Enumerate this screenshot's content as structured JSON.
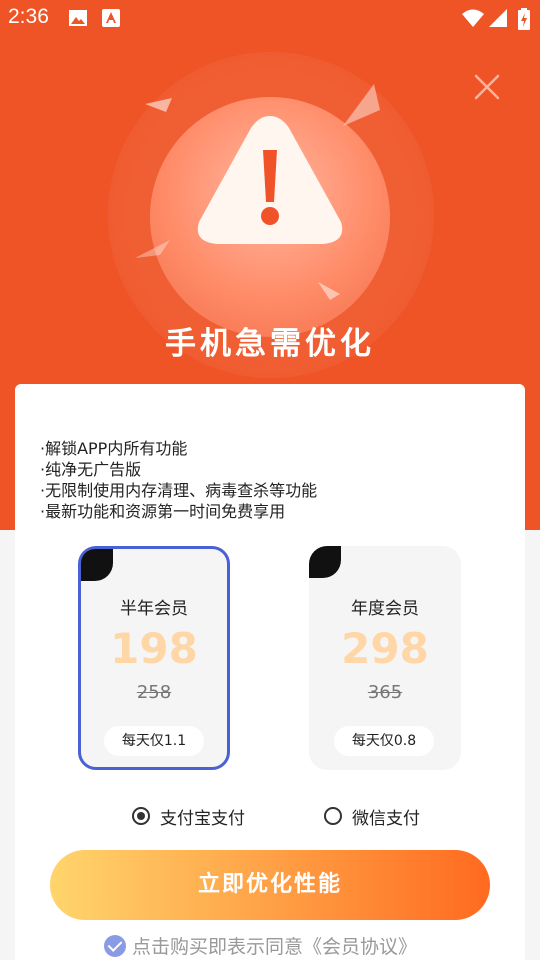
{
  "status_bar": {
    "time": "2:36"
  },
  "hero": {
    "title": "手机急需优化"
  },
  "features": [
    "·解锁APP内所有功能",
    "·纯净无广告版",
    "·无限制使用内存清理、病毒查杀等功能",
    "·最新功能和资源第一时间免费享用"
  ],
  "plans": [
    {
      "name": "半年会员",
      "price": "198",
      "original": "258",
      "daily": "每天仅1.1",
      "selected": true
    },
    {
      "name": "年度会员",
      "price": "298",
      "original": "365",
      "daily": "每天仅0.8",
      "selected": false
    }
  ],
  "payment": {
    "alipay": "支付宝支付",
    "wechat": "微信支付",
    "selected": "alipay"
  },
  "cta": {
    "label": "立即优化性能"
  },
  "agreement": {
    "text": "点击购买即表示同意《会员协议》"
  },
  "colors": {
    "brand": "#ef5426",
    "selected_border": "#4a61d6",
    "price": "#ffd6a6"
  }
}
